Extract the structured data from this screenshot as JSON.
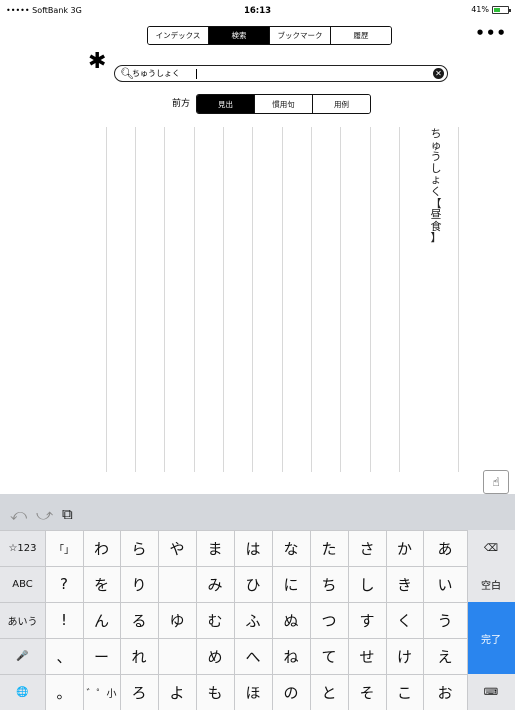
{
  "status": {
    "carrier": "••••• SoftBank  3G",
    "time": "16:13",
    "battery": "41%",
    "battery_level": 0.41
  },
  "tabs": [
    {
      "label": "インデックス",
      "active": false
    },
    {
      "label": "検索",
      "active": true
    },
    {
      "label": "ブックマーク",
      "active": false
    },
    {
      "label": "履歴",
      "active": false
    }
  ],
  "more_label": "•••",
  "search": {
    "asterisk": "✱",
    "query": "ちゅうしょく",
    "clear": "✕"
  },
  "mode": {
    "label": "前方",
    "options": [
      {
        "label": "見出",
        "active": true
      },
      {
        "label": "慣用句",
        "active": false
      },
      {
        "label": "用例",
        "active": false
      }
    ]
  },
  "result": {
    "chars": [
      "ち",
      "ゅ",
      "う",
      "し",
      "ょ",
      "く",
      "【",
      "昼",
      "食",
      "】"
    ]
  },
  "keyboard": {
    "tools": [
      "⤺",
      "⤻",
      "⧉"
    ],
    "rows": [
      [
        "☆123",
        "「」",
        "わ",
        "ら",
        "や",
        "ま",
        "は",
        "な",
        "た",
        "さ",
        "か",
        "あ",
        "⌫"
      ],
      [
        "ABC",
        "?",
        "を",
        "り",
        "",
        "み",
        "ひ",
        "に",
        "ち",
        "し",
        "き",
        "い",
        "空白"
      ],
      [
        "あいう",
        "!",
        "ん",
        "る",
        "ゆ",
        "む",
        "ふ",
        "ぬ",
        "つ",
        "す",
        "く",
        "う",
        ""
      ],
      [
        "🎤",
        "、",
        "ー",
        "れ",
        "",
        "め",
        "へ",
        "ね",
        "て",
        "せ",
        "け",
        "え",
        ""
      ],
      [
        "🌐",
        "。",
        "゛゜小",
        "ろ",
        "よ",
        "も",
        "ほ",
        "の",
        "と",
        "そ",
        "こ",
        "お",
        "⌨"
      ]
    ],
    "done": "完了"
  }
}
